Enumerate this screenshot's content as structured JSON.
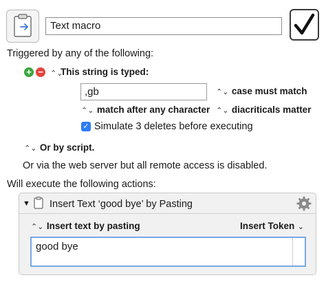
{
  "macro": {
    "name": "Text macro",
    "enabled": true
  },
  "triggers": {
    "heading": "Triggered by any of the following:",
    "add_symbol": "+",
    "remove_symbol": "−",
    "string_trigger_label": "This string is typed:",
    "typed_string": ",gb",
    "case_option": "case must match",
    "match_option": "match after any character",
    "diacriticals_option": "diacriticals matter",
    "simulate_deletes_label": "Simulate 3 deletes before executing",
    "simulate_deletes_checked": true,
    "script_trigger_label": "Or by script.",
    "web_server_text": "Or via the web server but all remote access is disabled."
  },
  "actions": {
    "heading": "Will execute the following actions:",
    "items": [
      {
        "title": "Insert Text ‘good bye’ by Pasting",
        "mode": "Insert text by pasting",
        "token_menu": "Insert Token",
        "text": "good bye"
      }
    ]
  },
  "colors": {
    "add_green": "#3aa63d",
    "remove_red": "#e0463f",
    "checkbox_blue": "#2e7cf6",
    "focus_blue": "#7aa7e6"
  },
  "icons": {
    "macro": "clipboard-icon",
    "enable": "checkmark-icon",
    "collapse": "disclosure-triangle-icon",
    "action": "clipboard-icon",
    "settings": "gear-icon",
    "updown": "up-down-chevron-icon"
  }
}
